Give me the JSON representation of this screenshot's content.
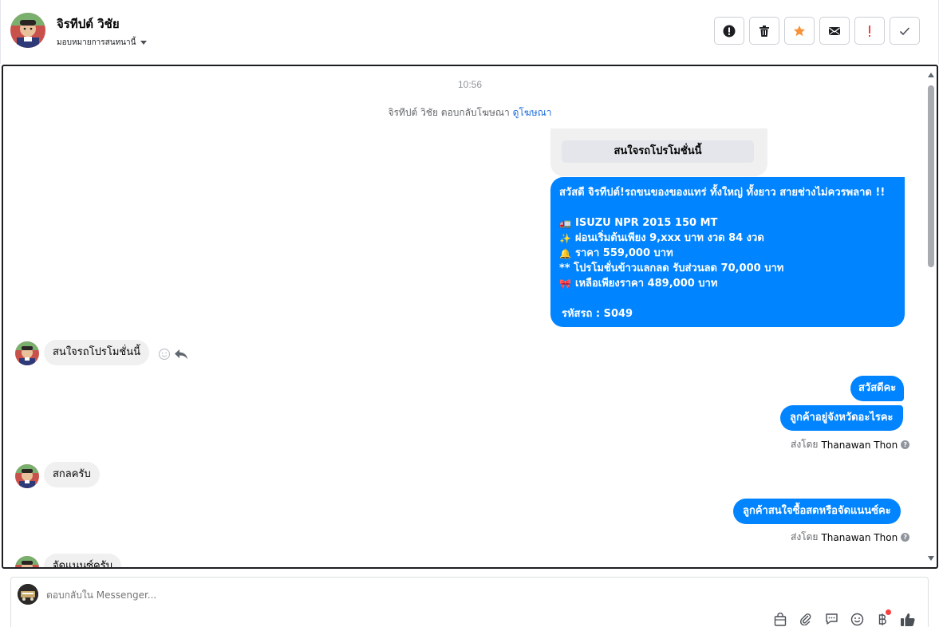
{
  "header": {
    "contact_name": "จิรทีปต์ วิชัย",
    "assign_label": "มอบหมายการสนทนานี้",
    "actions": [
      {
        "name": "spam-button",
        "icon": "alert-circle-icon"
      },
      {
        "name": "delete-button",
        "icon": "trash-icon"
      },
      {
        "name": "star-button",
        "icon": "star-icon"
      },
      {
        "name": "mark-unread-button",
        "icon": "envelope-icon"
      },
      {
        "name": "important-button",
        "icon": "exclamation-icon"
      },
      {
        "name": "mark-done-button",
        "icon": "check-icon"
      }
    ]
  },
  "conversation": {
    "timestamp": "10:56",
    "ad_reply_prefix": "จิรทีปต์ วิชัย ตอบกลับโฆษณา",
    "ad_reply_link": "ดูโฆษณา",
    "card_button_label": "สนใจรถโปรโมชั่นนี้",
    "promo_message": {
      "line1": "สวัสดี จิรทีปต์!รถขนของของแทร่ ทั้งใหญ่ ทั้งยาว สายช่างไม่ควรพลาด !!",
      "line2": "ISUZU NPR 2015 150 MT",
      "line3": "ผ่อนเริ่มต้นเพียง 9,xxx บาท งวด 84 งวด",
      "line4": "ราคา 559,000 บาท",
      "line5": "** โปรโมชั่นข้าวแลกลด รับส่วนลด 70,000 บาท",
      "line6": "เหลือเพียงราคา 489,000 บาท",
      "line7": "รหัสรถ : S049"
    },
    "incoming_1": "สนใจรถโปรโมชั่นนี้",
    "outgoing_1": "สวัสดีคะ",
    "outgoing_2": "ลูกค้าอยู่จังหวัดอะไรคะ",
    "sent_by_label": "ส่งโดย",
    "agent_name": "Thanawan Thon",
    "incoming_2": "สกลครับ",
    "outgoing_3": "ลูกค้าสนใจซื้อสดหรือจัดแนนซ์คะ",
    "incoming_3": "จัดแนนซ์ครับ"
  },
  "composer": {
    "placeholder": "ตอบกลับใน Messenger...",
    "icons": [
      "bag-icon",
      "paperclip-icon",
      "saved-reply-icon",
      "emoji-icon",
      "baht-icon",
      "thumbs-up-icon"
    ]
  },
  "colors": {
    "outgoing_bubble": "#0084ff",
    "incoming_bubble": "#f0f0f0",
    "link": "#216fdb",
    "star": "#f7923b",
    "important": "#fa3e3e"
  }
}
